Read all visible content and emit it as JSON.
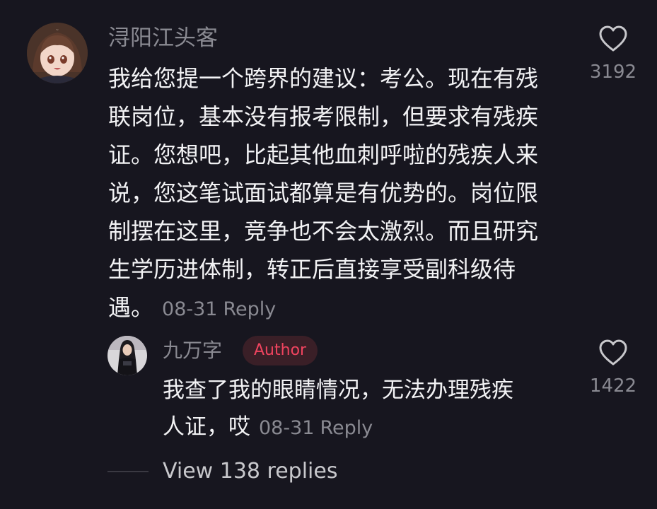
{
  "main_comment": {
    "username": "浔阳江头客",
    "lines": [
      "我给您提一个跨界的建议：考公。现在有残",
      "联岗位，基本没有报考限制，但要求有残疾",
      "证。您想吧，比起其他血刺呼啦的残疾人来",
      "说，您这笔试面试都算是有优势的。岗位限",
      "制摆在这里，竞争也不会太激烈。而且研究",
      "生学历进体制，转正后直接享受副科级待"
    ],
    "last_line": "遇。",
    "date": "08-31",
    "reply_label": "Reply",
    "likes": "3192",
    "avatar_icon": "avatar-anime-girl"
  },
  "reply_comment": {
    "username": "九万字",
    "badge": "Author",
    "lines": [
      "我查了我的眼睛情况，无法办理残疾"
    ],
    "last_line": "人证，哎",
    "date": "08-31",
    "reply_label": "Reply",
    "likes": "1422",
    "avatar_icon": "avatar-photo-person"
  },
  "view_replies": "View 138 replies",
  "colors": {
    "background": "#17161f",
    "text": "#f2f2f4",
    "muted": "#8a8a92",
    "author_badge_text": "#f0445f",
    "author_badge_bg": "#3a1f27"
  }
}
